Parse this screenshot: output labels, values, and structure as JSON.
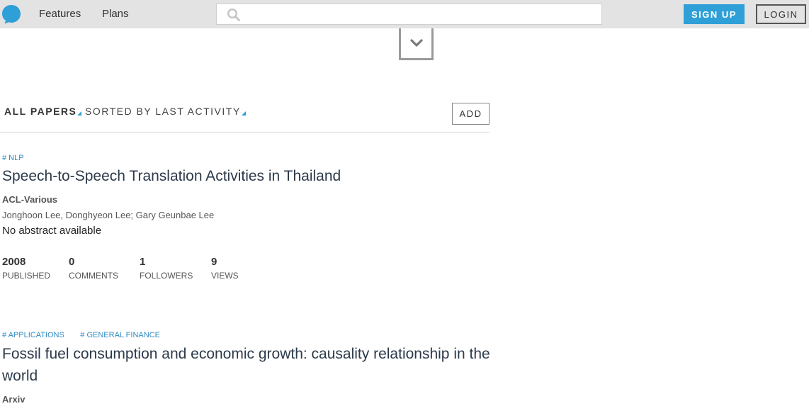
{
  "nav": {
    "links": [
      "Features",
      "Plans"
    ],
    "search_placeholder": "",
    "signup_label": "SIGN UP",
    "login_label": "LOGIN",
    "accent_color": "#2f9fd8"
  },
  "papers_header": {
    "filter_label": "ALL PAPERS",
    "sort_label": "SORTED BY LAST ACTIVITY",
    "add_label": "ADD"
  },
  "papers": [
    {
      "tags": [
        "# NLP"
      ],
      "title": "Speech-to-Speech Translation Activities in Thailand",
      "venue": "ACL-Various",
      "authors": "Jonghoon Lee, Donghyeon Lee; Gary Geunbae Lee",
      "abstract": "No abstract available",
      "stats": [
        {
          "value": "2008",
          "label": "PUBLISHED"
        },
        {
          "value": "0",
          "label": "COMMENTS"
        },
        {
          "value": "1",
          "label": "FOLLOWERS"
        },
        {
          "value": "9",
          "label": "VIEWS"
        }
      ]
    },
    {
      "tags": [
        "# APPLICATIONS",
        "# GENERAL FINANCE"
      ],
      "title": "Fossil fuel consumption and economic growth: causality relationship in the world",
      "venue": "Arxiv"
    }
  ]
}
